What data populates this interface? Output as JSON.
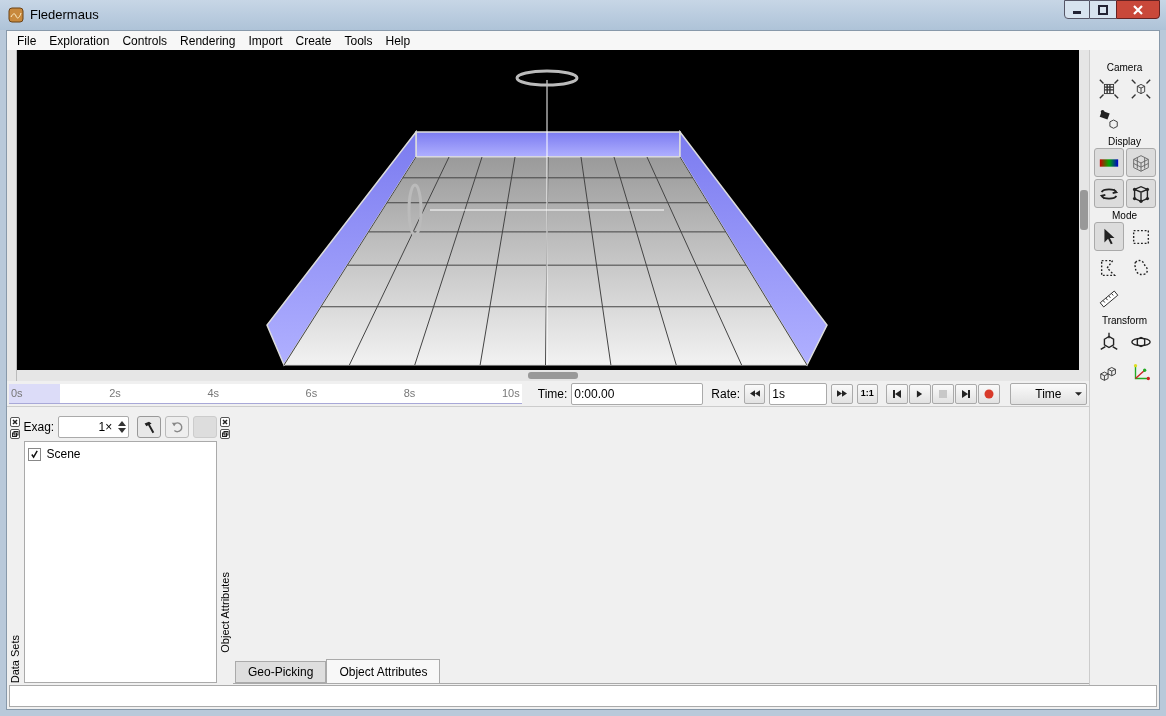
{
  "window": {
    "title": "Fledermaus"
  },
  "menu": [
    "File",
    "Exploration",
    "Controls",
    "Rendering",
    "Import",
    "Create",
    "Tools",
    "Help"
  ],
  "toolbar": [
    {
      "title": "Camera",
      "tools": [
        {
          "selected": false
        },
        {
          "selected": false
        },
        {
          "selected": false
        }
      ]
    },
    {
      "title": "Display",
      "tools": [
        {
          "selected": true
        },
        {
          "selected": true
        },
        {
          "selected": true
        },
        {
          "selected": true
        }
      ]
    },
    {
      "title": "Mode",
      "tools": [
        {
          "selected": true
        },
        {
          "selected": false
        },
        {
          "selected": false
        },
        {
          "selected": false
        },
        {
          "selected": false
        }
      ]
    },
    {
      "title": "Transform",
      "tools": [
        {
          "selected": false
        },
        {
          "selected": false
        },
        {
          "selected": false
        },
        {
          "selected": false
        }
      ]
    }
  ],
  "timeline": {
    "ticks": [
      "0s",
      "2s",
      "4s",
      "6s",
      "8s",
      "10s"
    ],
    "level": 0.1,
    "time_label": "Time:",
    "time_value": "0:00.00",
    "rate_label": "Rate:",
    "rate_value": "1s",
    "ratio_button": "1:1",
    "stop_disabled": true,
    "mode_select": "Time"
  },
  "data_sets": {
    "exag_label": "Exag:",
    "exag_value": "1×",
    "items": [
      {
        "label": "Scene",
        "checked": true
      }
    ],
    "side_label": "Data Sets"
  },
  "attributes": {
    "side_label": "Object Attributes",
    "tabs": [
      {
        "label": "Geo-Picking",
        "selected": false
      },
      {
        "label": "Object Attributes",
        "selected": true
      }
    ]
  }
}
